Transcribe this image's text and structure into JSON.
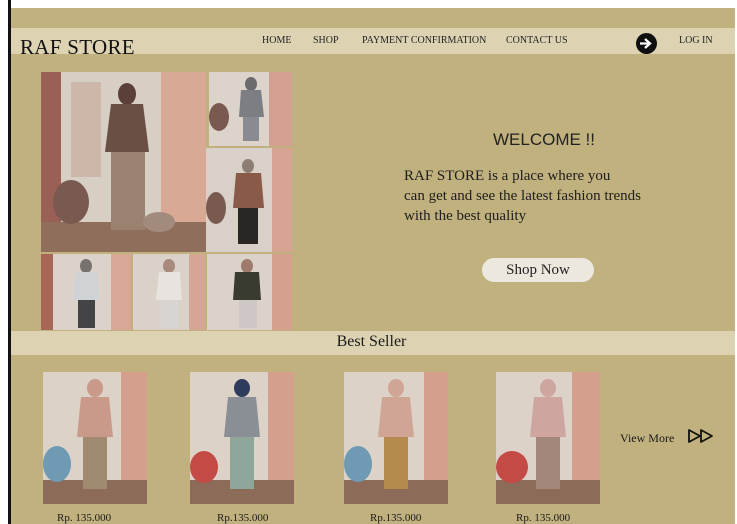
{
  "brand": "RAF STORE",
  "nav": {
    "home": "HOME",
    "shop": "SHOP",
    "payment": "PAYMENT CONFIRMATION",
    "contact": "CONTACT US",
    "login": "LOG IN"
  },
  "hero": {
    "welcome_title": "WELCOME !!",
    "welcome_line1": "RAF STORE is a place where you",
    "welcome_line2": "can get and see the latest fashion trends",
    "welcome_line3": "with the best quality",
    "cta_label": "Shop Now"
  },
  "best_seller": {
    "title": "Best Seller",
    "products": [
      {
        "price": "Rp. 135.000",
        "outfit": "#a08a70",
        "hijab": "#c99a8a"
      },
      {
        "price": "Rp.135.000",
        "outfit": "#8ea79a",
        "hijab": "#2f3b5c"
      },
      {
        "price": "Rp.135.000",
        "outfit": "#b48a4d",
        "hijab": "#d1a596"
      },
      {
        "price": "Rp. 135.000",
        "outfit": "#a3877a",
        "hijab": "#cfa5a0"
      }
    ],
    "view_more": "View More"
  },
  "colors": {
    "page_bg": "#c0b17e",
    "bar_bg": "#ddd3b3",
    "button_bg": "#ece8dd"
  },
  "icons": [
    "arrow-right-circle-icon",
    "fast-forward-icon"
  ]
}
